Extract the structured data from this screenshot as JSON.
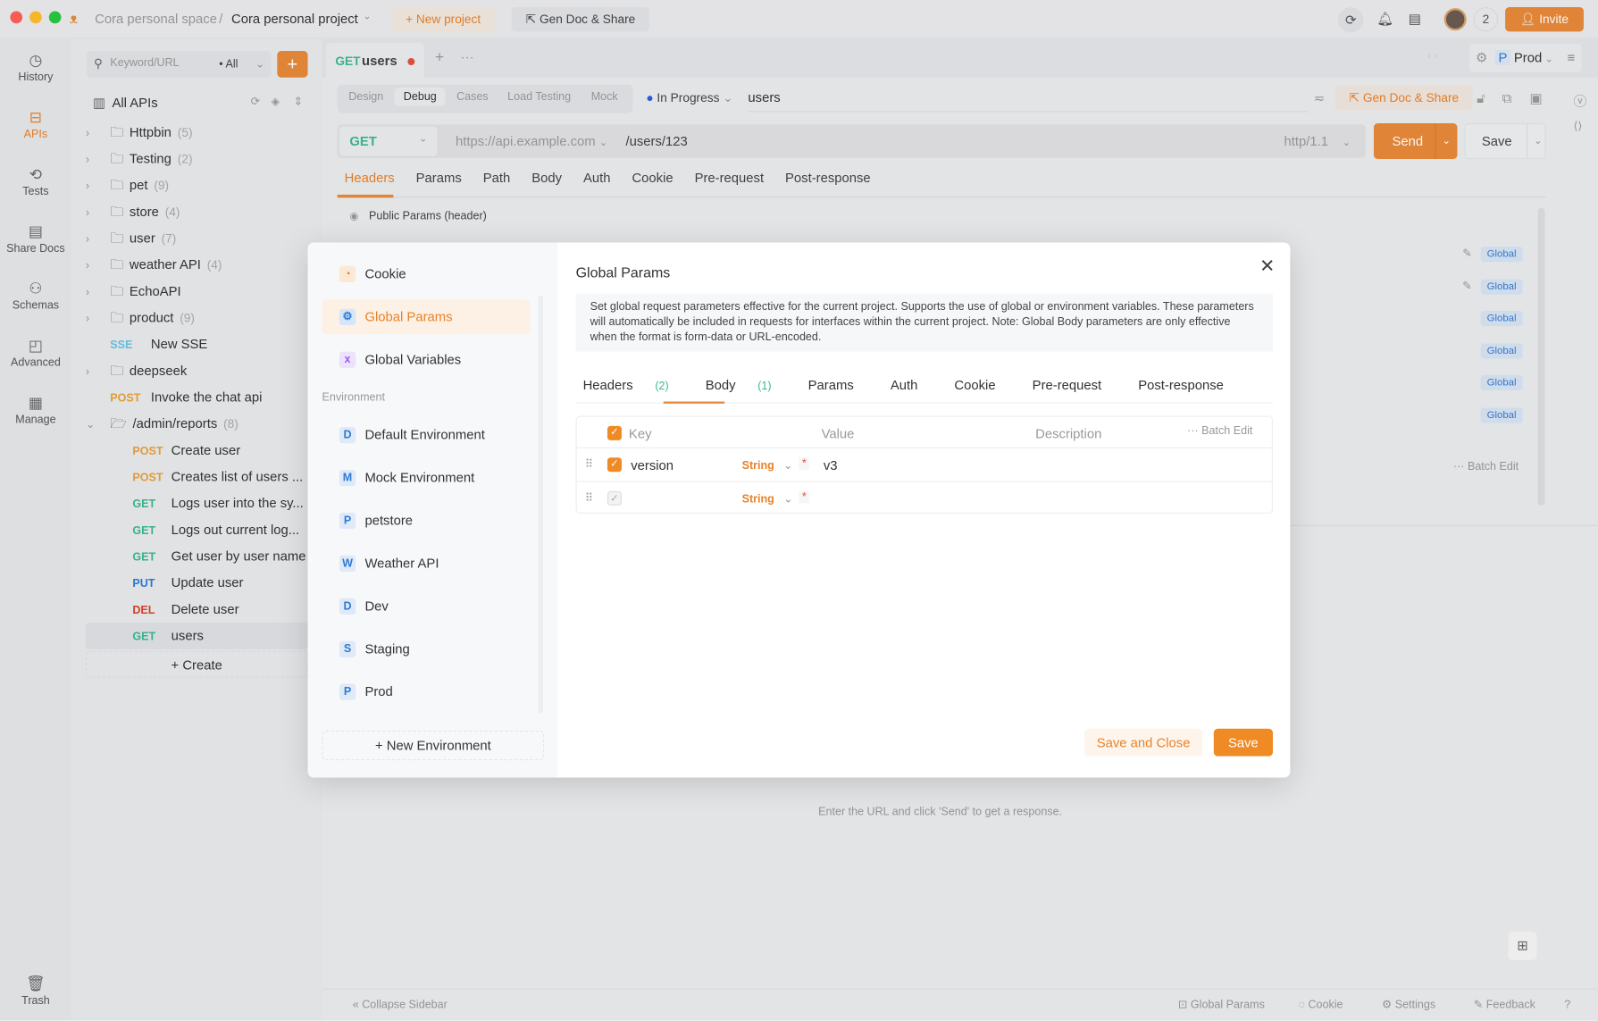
{
  "titlebar": {
    "workspace": "Cora personal space",
    "separator": "/",
    "project": "Cora personal project",
    "new_project": "New project",
    "gen_doc": "Gen Doc & Share",
    "member_count": "2",
    "invite": "Invite"
  },
  "rail": [
    {
      "label": "History",
      "icon": "history-icon"
    },
    {
      "label": "APIs",
      "icon": "apis-icon"
    },
    {
      "label": "Tests",
      "icon": "tests-icon"
    },
    {
      "label": "Share Docs",
      "icon": "share-docs-icon"
    },
    {
      "label": "Schemas",
      "icon": "schemas-icon"
    },
    {
      "label": "Advanced",
      "icon": "advanced-icon"
    },
    {
      "label": "Manage",
      "icon": "manage-icon"
    }
  ],
  "rail_trash": "Trash",
  "tree": {
    "search_placeholder": "Keyword/URL",
    "filter": "All",
    "all_apis": "All APIs",
    "items": [
      {
        "type": "folder",
        "label": "Httpbin",
        "count": "(5)"
      },
      {
        "type": "folder",
        "label": "Testing",
        "count": "(2)"
      },
      {
        "type": "folder",
        "label": "pet",
        "count": "(9)"
      },
      {
        "type": "folder",
        "label": "store",
        "count": "(4)"
      },
      {
        "type": "folder",
        "label": "user",
        "count": "(7)"
      },
      {
        "type": "folder",
        "label": "weather API",
        "count": "(4)"
      },
      {
        "type": "folder",
        "label": "EchoAPI",
        "count": ""
      },
      {
        "type": "folder",
        "label": "product",
        "count": "(9)"
      },
      {
        "type": "api",
        "method": "SSE",
        "label": "New SSE"
      },
      {
        "type": "folder",
        "label": "deepseek",
        "count": ""
      },
      {
        "type": "api",
        "method": "POST",
        "label": "Invoke the chat api"
      },
      {
        "type": "open-folder",
        "label": "/admin/reports",
        "count": "(8)"
      }
    ],
    "children": [
      {
        "method": "POST",
        "label": "Create user"
      },
      {
        "method": "POST",
        "label": "Creates list of users ..."
      },
      {
        "method": "GET",
        "label": "Logs user into the sy..."
      },
      {
        "method": "GET",
        "label": "Logs out current log..."
      },
      {
        "method": "GET",
        "label": "Get user by user name"
      },
      {
        "method": "PUT",
        "label": "Update user"
      },
      {
        "method": "DEL",
        "label": "Delete user"
      },
      {
        "method": "GET",
        "label": "users"
      }
    ],
    "create": "Create"
  },
  "main": {
    "tab_method": "GET",
    "tab_name": "users",
    "env": "Prod",
    "env_letter": "P",
    "modes": [
      "Design",
      "Debug",
      "Cases",
      "Load Testing",
      "Mock"
    ],
    "status": "In Progress",
    "api_name": "users",
    "gen_doc": "Gen Doc & Share",
    "method": "GET",
    "base_url": "https://api.example.com",
    "path": "/users/123",
    "protocol": "http/1.1",
    "send": "Send",
    "save": "Save",
    "req_tabs": [
      "Headers",
      "Params",
      "Path",
      "Body",
      "Auth",
      "Cookie",
      "Pre-request",
      "Post-response"
    ],
    "public_params": "Public Params  (header)",
    "global_badge": "Global",
    "batch_edit": "Batch Edit",
    "response_hint": "Enter the URL and click 'Send' to get a response."
  },
  "footer": {
    "collapse": "Collapse Sidebar",
    "global_params": "Global Params",
    "cookie": "Cookie",
    "settings": "Settings",
    "feedback": "Feedback"
  },
  "modal": {
    "menu": [
      {
        "label": "Cookie"
      },
      {
        "label": "Global Params"
      },
      {
        "label": "Global Variables"
      }
    ],
    "env_heading": "Environment",
    "envs": [
      {
        "letter": "D",
        "label": "Default Environment"
      },
      {
        "letter": "M",
        "label": "Mock Environment"
      },
      {
        "letter": "P",
        "label": "petstore"
      },
      {
        "letter": "W",
        "label": "Weather API"
      },
      {
        "letter": "D",
        "label": "Dev"
      },
      {
        "letter": "S",
        "label": "Staging"
      },
      {
        "letter": "P",
        "label": "Prod"
      }
    ],
    "new_env": "New Environment",
    "title": "Global Params",
    "description": "Set global request parameters effective for the current project. Supports the use of global or environment variables. These parameters will automatically be included in requests for interfaces within the current project. Note: Global Body parameters are only effective when the format is form-data or URL-encoded.",
    "tabs": [
      {
        "label": "Headers",
        "count": "(2)"
      },
      {
        "label": "Body",
        "count": "(1)"
      },
      {
        "label": "Params"
      },
      {
        "label": "Auth"
      },
      {
        "label": "Cookie"
      },
      {
        "label": "Pre-request"
      },
      {
        "label": "Post-response"
      }
    ],
    "columns": {
      "key": "Key",
      "value": "Value",
      "description": "Description",
      "batch_edit": "Batch Edit"
    },
    "rows": [
      {
        "key": "version",
        "type": "String",
        "value": "v3",
        "checked": true
      },
      {
        "key": "",
        "type": "String",
        "value": "",
        "checked": false
      }
    ],
    "save_close": "Save and Close",
    "save": "Save"
  },
  "colors": {
    "accent": "#f08a24",
    "get": "#3ab890",
    "post": "#e6a23c",
    "put": "#2f7bd6",
    "del": "#d9402f"
  }
}
